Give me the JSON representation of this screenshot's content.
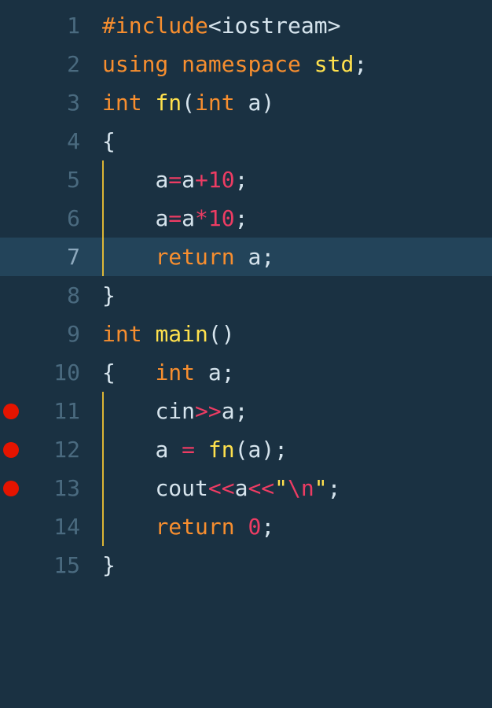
{
  "editor": {
    "highlightedLine": 7,
    "lines": [
      {
        "num": 1,
        "breakpoint": false,
        "indentGuide": false,
        "indent": "",
        "tokens": [
          {
            "cls": "tok-preproc",
            "t": "#include"
          },
          {
            "cls": "tok-default",
            "t": "<iostream>"
          }
        ]
      },
      {
        "num": 2,
        "breakpoint": false,
        "indentGuide": false,
        "indent": "",
        "tokens": [
          {
            "cls": "tok-keyword",
            "t": "using"
          },
          {
            "cls": "tok-default",
            "t": " "
          },
          {
            "cls": "tok-keyword",
            "t": "namespace"
          },
          {
            "cls": "tok-default",
            "t": " "
          },
          {
            "cls": "tok-func",
            "t": "std"
          },
          {
            "cls": "tok-punct",
            "t": ";"
          }
        ]
      },
      {
        "num": 3,
        "breakpoint": false,
        "indentGuide": false,
        "indent": "",
        "tokens": [
          {
            "cls": "tok-keyword",
            "t": "int"
          },
          {
            "cls": "tok-default",
            "t": " "
          },
          {
            "cls": "tok-func",
            "t": "fn"
          },
          {
            "cls": "tok-punct",
            "t": "("
          },
          {
            "cls": "tok-keyword",
            "t": "int"
          },
          {
            "cls": "tok-default",
            "t": " a"
          },
          {
            "cls": "tok-punct",
            "t": ")"
          }
        ]
      },
      {
        "num": 4,
        "breakpoint": false,
        "indentGuide": false,
        "indent": "",
        "tokens": [
          {
            "cls": "tok-punct",
            "t": "{"
          }
        ]
      },
      {
        "num": 5,
        "breakpoint": false,
        "indentGuide": true,
        "indent": "    ",
        "tokens": [
          {
            "cls": "tok-default",
            "t": "a"
          },
          {
            "cls": "tok-op",
            "t": "="
          },
          {
            "cls": "tok-default",
            "t": "a"
          },
          {
            "cls": "tok-op",
            "t": "+"
          },
          {
            "cls": "tok-num",
            "t": "10"
          },
          {
            "cls": "tok-punct",
            "t": ";"
          }
        ]
      },
      {
        "num": 6,
        "breakpoint": false,
        "indentGuide": true,
        "indent": "    ",
        "tokens": [
          {
            "cls": "tok-default",
            "t": "a"
          },
          {
            "cls": "tok-op",
            "t": "="
          },
          {
            "cls": "tok-default",
            "t": "a"
          },
          {
            "cls": "tok-op",
            "t": "*"
          },
          {
            "cls": "tok-num",
            "t": "10"
          },
          {
            "cls": "tok-punct",
            "t": ";"
          }
        ]
      },
      {
        "num": 7,
        "breakpoint": false,
        "indentGuide": true,
        "indent": "    ",
        "tokens": [
          {
            "cls": "tok-keyword",
            "t": "return"
          },
          {
            "cls": "tok-default",
            "t": " a"
          },
          {
            "cls": "tok-punct",
            "t": ";"
          }
        ]
      },
      {
        "num": 8,
        "breakpoint": false,
        "indentGuide": false,
        "indent": "",
        "tokens": [
          {
            "cls": "tok-punct",
            "t": "}"
          }
        ]
      },
      {
        "num": 9,
        "breakpoint": false,
        "indentGuide": false,
        "indent": "",
        "tokens": [
          {
            "cls": "tok-keyword",
            "t": "int"
          },
          {
            "cls": "tok-default",
            "t": " "
          },
          {
            "cls": "tok-func",
            "t": "main"
          },
          {
            "cls": "tok-punct",
            "t": "()"
          }
        ]
      },
      {
        "num": 10,
        "breakpoint": false,
        "indentGuide": false,
        "indent": "",
        "tokens": [
          {
            "cls": "tok-punct",
            "t": "{"
          },
          {
            "cls": "tok-default",
            "t": "   "
          },
          {
            "cls": "tok-keyword",
            "t": "int"
          },
          {
            "cls": "tok-default",
            "t": " a"
          },
          {
            "cls": "tok-punct",
            "t": ";"
          }
        ]
      },
      {
        "num": 11,
        "breakpoint": true,
        "indentGuide": true,
        "indent": "    ",
        "tokens": [
          {
            "cls": "tok-default",
            "t": "cin"
          },
          {
            "cls": "tok-op",
            "t": ">>"
          },
          {
            "cls": "tok-default",
            "t": "a"
          },
          {
            "cls": "tok-punct",
            "t": ";"
          }
        ]
      },
      {
        "num": 12,
        "breakpoint": true,
        "indentGuide": true,
        "indent": "    ",
        "tokens": [
          {
            "cls": "tok-default",
            "t": "a "
          },
          {
            "cls": "tok-op",
            "t": "="
          },
          {
            "cls": "tok-default",
            "t": " "
          },
          {
            "cls": "tok-func",
            "t": "fn"
          },
          {
            "cls": "tok-punct",
            "t": "("
          },
          {
            "cls": "tok-default",
            "t": "a"
          },
          {
            "cls": "tok-punct",
            "t": ")"
          },
          {
            "cls": "tok-punct",
            "t": ";"
          }
        ]
      },
      {
        "num": 13,
        "breakpoint": true,
        "indentGuide": true,
        "indent": "    ",
        "tokens": [
          {
            "cls": "tok-default",
            "t": "cout"
          },
          {
            "cls": "tok-op",
            "t": "<<"
          },
          {
            "cls": "tok-default",
            "t": "a"
          },
          {
            "cls": "tok-op",
            "t": "<<"
          },
          {
            "cls": "tok-str",
            "t": "\""
          },
          {
            "cls": "tok-esc",
            "t": "\\n"
          },
          {
            "cls": "tok-str",
            "t": "\""
          },
          {
            "cls": "tok-punct",
            "t": ";"
          }
        ]
      },
      {
        "num": 14,
        "breakpoint": false,
        "indentGuide": true,
        "indent": "    ",
        "tokens": [
          {
            "cls": "tok-keyword",
            "t": "return"
          },
          {
            "cls": "tok-default",
            "t": " "
          },
          {
            "cls": "tok-num",
            "t": "0"
          },
          {
            "cls": "tok-punct",
            "t": ";"
          }
        ]
      },
      {
        "num": 15,
        "breakpoint": false,
        "indentGuide": false,
        "indent": "",
        "tokens": [
          {
            "cls": "tok-punct",
            "t": "}"
          }
        ]
      }
    ]
  }
}
